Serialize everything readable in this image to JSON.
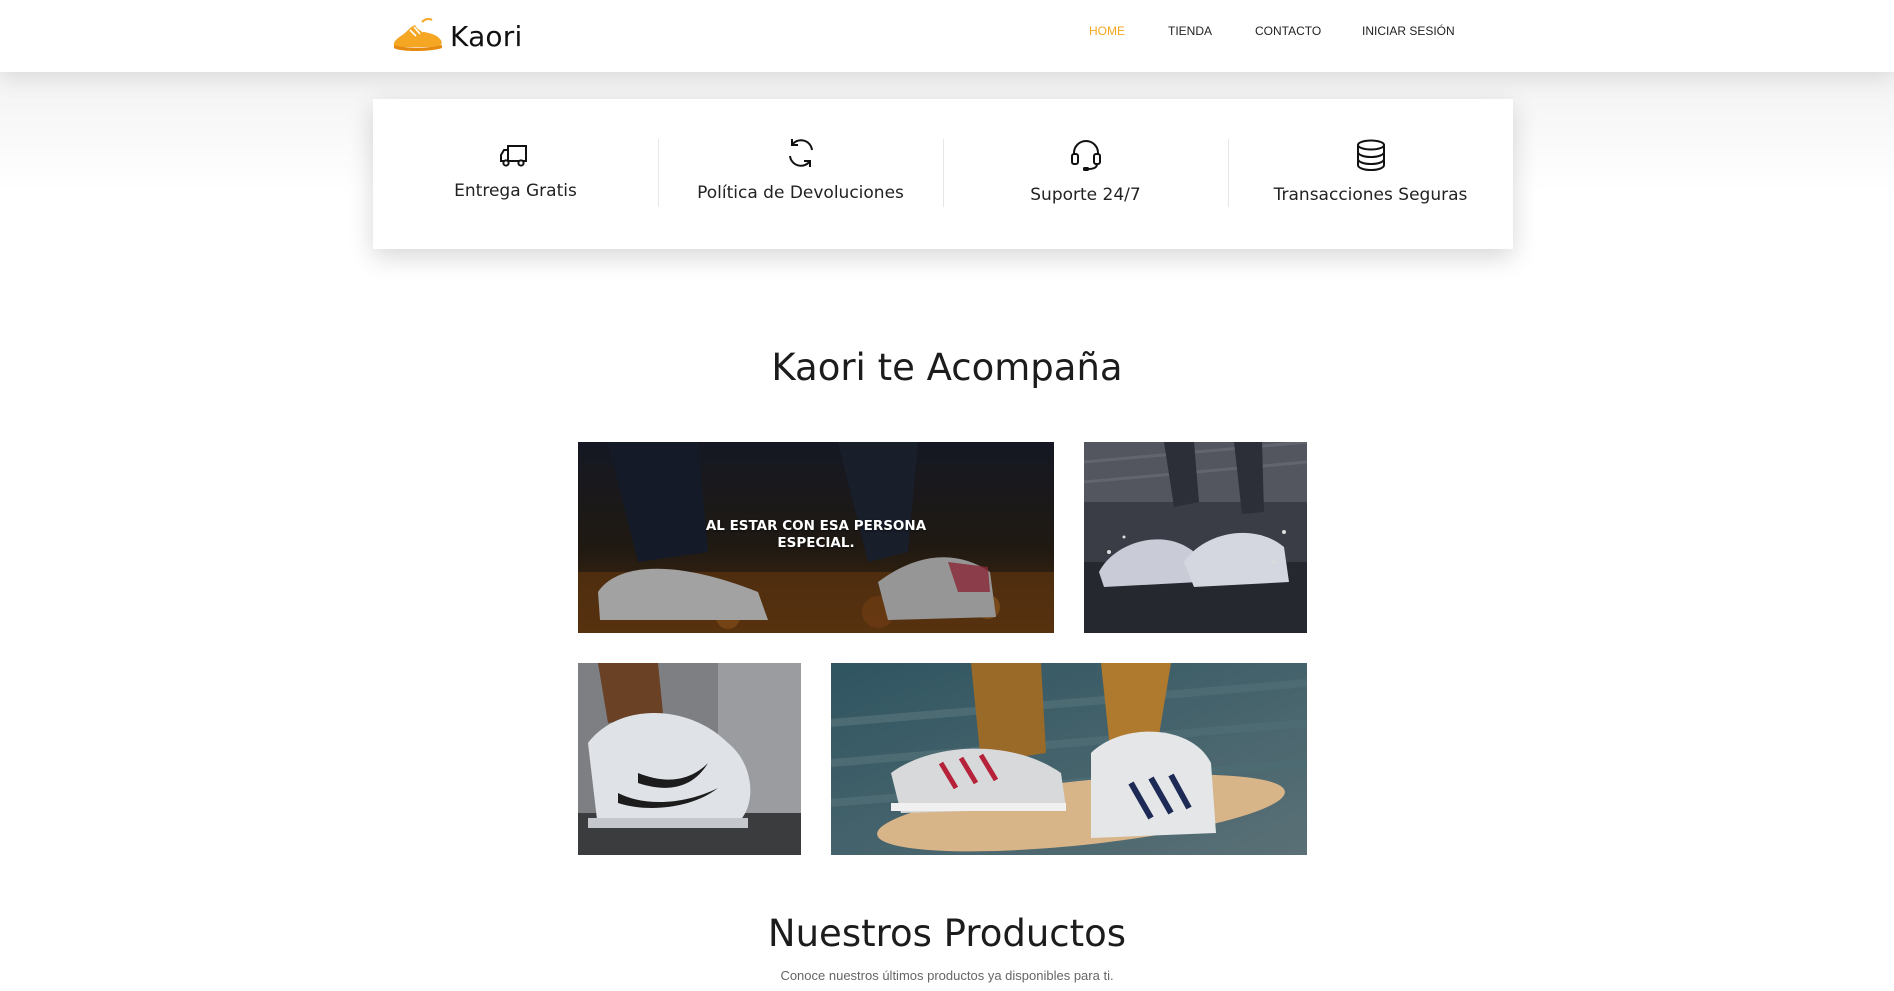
{
  "brand": {
    "name": "Kaori",
    "logo_icon": "sneaker-icon",
    "accent": "#f5a623"
  },
  "nav": {
    "items": [
      {
        "label": "HOME",
        "active": true
      },
      {
        "label": "TIENDA",
        "active": false
      },
      {
        "label": "CONTACTO",
        "active": false
      },
      {
        "label": "INICIAR SESIÓN",
        "active": false
      }
    ]
  },
  "features": [
    {
      "label": "Entrega Gratis",
      "icon": "truck-icon"
    },
    {
      "label": "Política de Devoluciones",
      "icon": "refresh-icon"
    },
    {
      "label": "Suporte 24/7",
      "icon": "headset-icon"
    },
    {
      "label": "Transacciones Seguras",
      "icon": "coins-stack-icon"
    }
  ],
  "gallery": {
    "title": "Kaori te Acompaña",
    "caption_line1": "AL ESTAR CON ESA PERSONA",
    "caption_line2": "ESPECIAL."
  },
  "products": {
    "title": "Nuestros Productos",
    "subtitle": "Conoce nuestros últimos productos ya disponibles para ti."
  }
}
